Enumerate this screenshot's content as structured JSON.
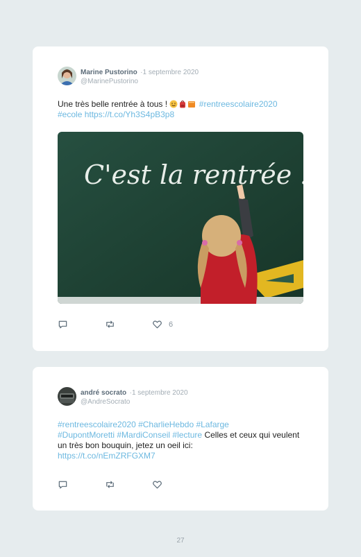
{
  "tweets": [
    {
      "author": "Marine Pustorino",
      "separator": "·",
      "date": "1 septembre 2020",
      "handle": "@MarinePustorino",
      "text_main": "Une très belle rentrée à tous !",
      "emojis": [
        "winking-face",
        "red-backpack",
        "orange-book"
      ],
      "hashtag1": "#rentreescolaire2020",
      "hashtag2": "#ecole",
      "link": "https://t.co/Yh3S4pB3p8",
      "image_text": "C'est la rentrée !",
      "likes": "6"
    },
    {
      "author": "andré socrato",
      "separator": "·",
      "date": "1 septembre 2020",
      "handle": "@AndreSocrato",
      "hashtags_line1": "#rentreescolaire2020 #CharlieHebdo #Lafarge",
      "hashtags_line2": "#DupontMoretti #MardiConseil #lecture",
      "text_plain": " Celles et ceux qui veulent un très bon bouquin, jetez un oeil ici:",
      "link": "https://t.co/nEmZRFGXM7"
    }
  ],
  "page_number": "27",
  "colors": {
    "background": "#e6ecee",
    "card": "#ffffff",
    "link": "#6cb8e0",
    "name": "#5b6b78",
    "muted": "#a3adb5",
    "chalkboard": "#1f4436"
  },
  "icons": [
    "reply-icon",
    "retweet-icon",
    "like-icon"
  ]
}
